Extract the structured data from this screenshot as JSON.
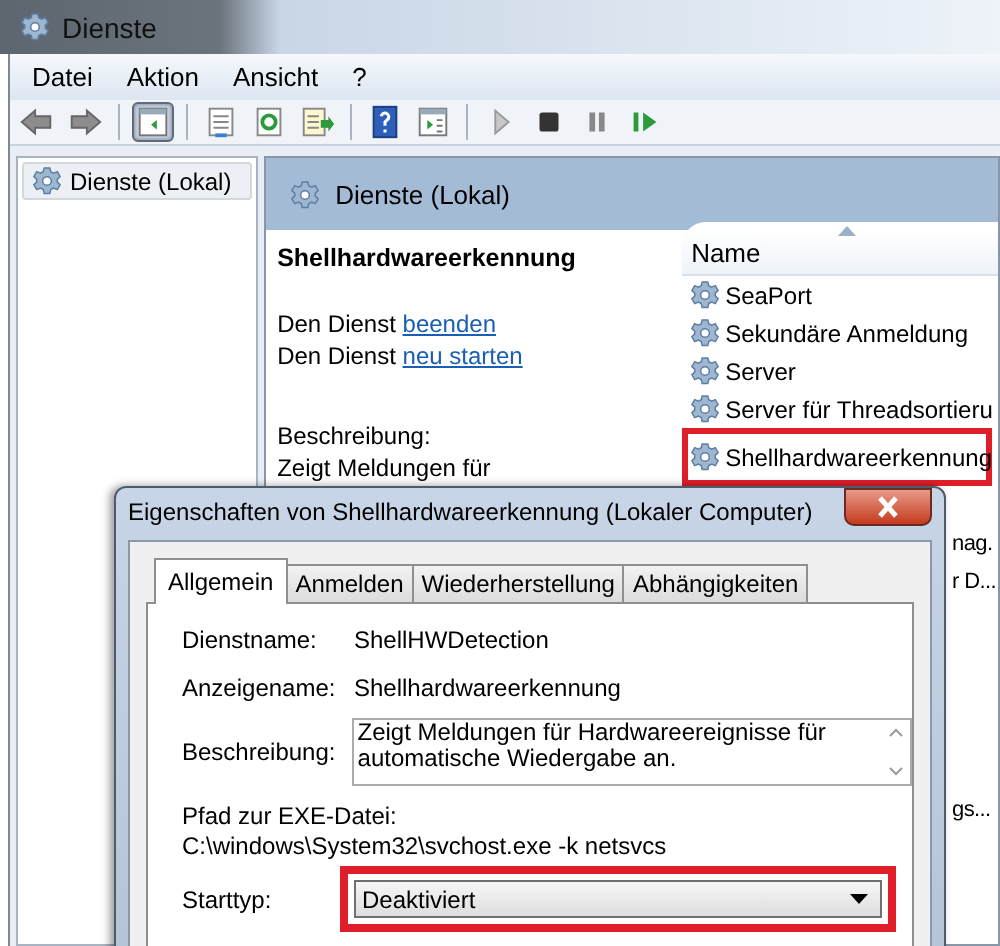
{
  "window": {
    "title": "Dienste"
  },
  "menu": [
    "Datei",
    "Aktion",
    "Ansicht",
    "?"
  ],
  "toolbar": [
    [
      {
        "kind": "back",
        "selected": false
      },
      {
        "kind": "forward",
        "selected": false
      }
    ],
    [
      {
        "kind": "console-tree",
        "selected": true
      }
    ],
    [
      {
        "kind": "properties",
        "selected": false
      },
      {
        "kind": "refresh",
        "selected": false
      },
      {
        "kind": "export",
        "selected": false
      }
    ],
    [
      {
        "kind": "help",
        "selected": false
      },
      {
        "kind": "action-pane",
        "selected": false
      }
    ],
    [
      {
        "kind": "play",
        "selected": false
      },
      {
        "kind": "stop",
        "selected": false
      },
      {
        "kind": "pause",
        "selected": false
      },
      {
        "kind": "resume",
        "selected": false
      }
    ]
  ],
  "tree": {
    "items": [
      {
        "label": "Dienste (Lokal)",
        "selected": true
      }
    ]
  },
  "panel": {
    "header": "Dienste (Lokal)",
    "details": {
      "title": "Shellhardwareerkennung",
      "actions": [
        {
          "prefix": "Den Dienst",
          "link": "beenden"
        },
        {
          "prefix": "Den Dienst",
          "link": "neu starten"
        }
      ],
      "description_label": "Beschreibung:",
      "description": "Zeigt Meldungen für"
    },
    "list": {
      "column": "Name",
      "rows": [
        {
          "name": "SeaPort",
          "marked": false
        },
        {
          "name": "Sekundäre Anmeldung",
          "marked": false
        },
        {
          "name": "Server",
          "marked": false
        },
        {
          "name": "Server für Threadsortieru",
          "marked": false
        },
        {
          "name": "Shellhardwareerkennung",
          "marked": true
        }
      ],
      "column_2": [
        "nag.",
        "r D...",
        "gs..."
      ]
    }
  },
  "dialog": {
    "title": "Eigenschaften von Shellhardwareerkennung (Lokaler Computer)",
    "tabs": [
      {
        "label": "Allgemein",
        "selected": true
      },
      {
        "label": "Anmelden",
        "selected": false
      },
      {
        "label": "Wiederherstellung",
        "selected": false
      },
      {
        "label": "Abhängigkeiten",
        "selected": false
      }
    ],
    "service_name_label": "Dienstname:",
    "service_name": "ShellHWDetection",
    "display_name_label": "Anzeigename:",
    "display_name": "Shellhardwareerkennung",
    "description_label": "Beschreibung:",
    "description": "Zeigt Meldungen für Hardwareereignisse für automatische Wiedergabe an.",
    "path_label": "Pfad zur EXE-Datei:",
    "path": "C:\\windows\\System32\\svchost.exe -k netsvcs",
    "startup_label": "Starttyp:",
    "startup": {
      "value": "Deaktiviert",
      "marked": true
    }
  }
}
